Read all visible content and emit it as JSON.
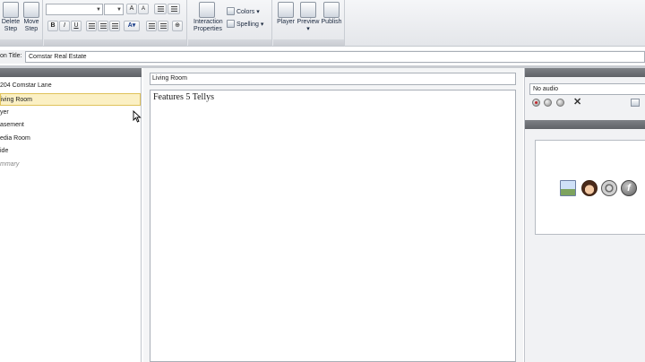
{
  "ribbon": {
    "delete_step": "Delete\nStep",
    "move_step": "Move\nStep",
    "bold": "B",
    "italic": "I",
    "underline": "U",
    "interaction_properties": "Interaction\nProperties",
    "colors": "Colors",
    "spelling": "Spelling",
    "player": "Player",
    "preview": "Preview",
    "publish": "Publish"
  },
  "title_bar": {
    "label": "on Title:",
    "value": "Comstar Real Estate"
  },
  "steps": [
    {
      "label": "204 Comstar Lane",
      "selected": false,
      "dim": false
    },
    {
      "label": "iving Room",
      "selected": true,
      "dim": false
    },
    {
      "label": "yer",
      "selected": false,
      "dim": false
    },
    {
      "label": "asement",
      "selected": false,
      "dim": false
    },
    {
      "label": "edia Room",
      "selected": false,
      "dim": false
    },
    {
      "label": "ide",
      "selected": false,
      "dim": false
    },
    {
      "label": "mmary",
      "selected": false,
      "dim": true
    }
  ],
  "editor": {
    "step_name": "Living Room",
    "body_text": "Features 5 Tellys"
  },
  "audio": {
    "selected": "No audio"
  },
  "icons": {
    "image": "image-icon",
    "character": "character-icon",
    "film": "film-reel-icon",
    "flash": "flash-icon"
  }
}
